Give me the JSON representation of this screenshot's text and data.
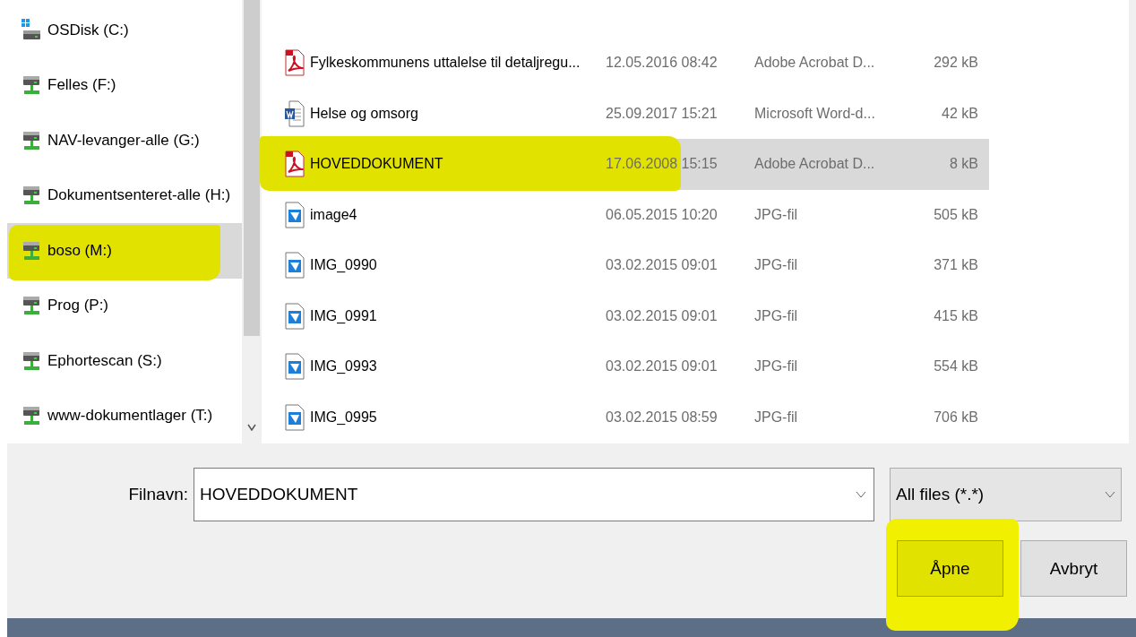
{
  "navigation": [
    {
      "label": "OSDisk (C:)",
      "kind": "local",
      "selected": false,
      "highlighted": false
    },
    {
      "label": "Felles (F:)",
      "kind": "network",
      "selected": false,
      "highlighted": false
    },
    {
      "label": "NAV-levanger-alle (G:)",
      "kind": "network",
      "selected": false,
      "highlighted": false
    },
    {
      "label": "Dokumentsenteret-alle (H:)",
      "kind": "network",
      "selected": false,
      "highlighted": false
    },
    {
      "label": "boso (M:)",
      "kind": "network",
      "selected": true,
      "highlighted": true
    },
    {
      "label": "Prog (P:)",
      "kind": "network",
      "selected": false,
      "highlighted": false
    },
    {
      "label": "Ephortescan (S:)",
      "kind": "network",
      "selected": false,
      "highlighted": false
    },
    {
      "label": "www-dokumentlager (T:)",
      "kind": "network",
      "selected": false,
      "highlighted": false
    }
  ],
  "files": [
    {
      "name": "Fylkeskommunens uttalelse til detaljregu...",
      "date": "12.05.2016 08:42",
      "type": "Adobe Acrobat D...",
      "size": "292 kB",
      "kind": "pdf",
      "selected": false,
      "highlighted": false
    },
    {
      "name": "Helse og omsorg",
      "date": "25.09.2017 15:21",
      "type": "Microsoft Word-d...",
      "size": "42 kB",
      "kind": "word",
      "selected": false,
      "highlighted": false
    },
    {
      "name": "HOVEDDOKUMENT",
      "date": "17.06.2008 15:15",
      "type": "Adobe Acrobat D...",
      "size": "8 kB",
      "kind": "pdf",
      "selected": true,
      "highlighted": true
    },
    {
      "name": "image4",
      "date": "06.05.2015 10:20",
      "type": "JPG-fil",
      "size": "505 kB",
      "kind": "image",
      "selected": false,
      "highlighted": false
    },
    {
      "name": "IMG_0990",
      "date": "03.02.2015 09:01",
      "type": "JPG-fil",
      "size": "371 kB",
      "kind": "image",
      "selected": false,
      "highlighted": false
    },
    {
      "name": "IMG_0991",
      "date": "03.02.2015 09:01",
      "type": "JPG-fil",
      "size": "415 kB",
      "kind": "image",
      "selected": false,
      "highlighted": false
    },
    {
      "name": "IMG_0993",
      "date": "03.02.2015 09:01",
      "type": "JPG-fil",
      "size": "554 kB",
      "kind": "image",
      "selected": false,
      "highlighted": false
    },
    {
      "name": "IMG_0995",
      "date": "03.02.2015 08:59",
      "type": "JPG-fil",
      "size": "706 kB",
      "kind": "image",
      "selected": false,
      "highlighted": false
    }
  ],
  "filename": {
    "label": "Filnavn:",
    "value": "HOVEDDOKUMENT"
  },
  "file_type": {
    "value": "All files (*.*)"
  },
  "buttons": [
    {
      "label": "Åpne",
      "highlighted": true
    },
    {
      "label": "Avbryt",
      "highlighted": false
    }
  ]
}
